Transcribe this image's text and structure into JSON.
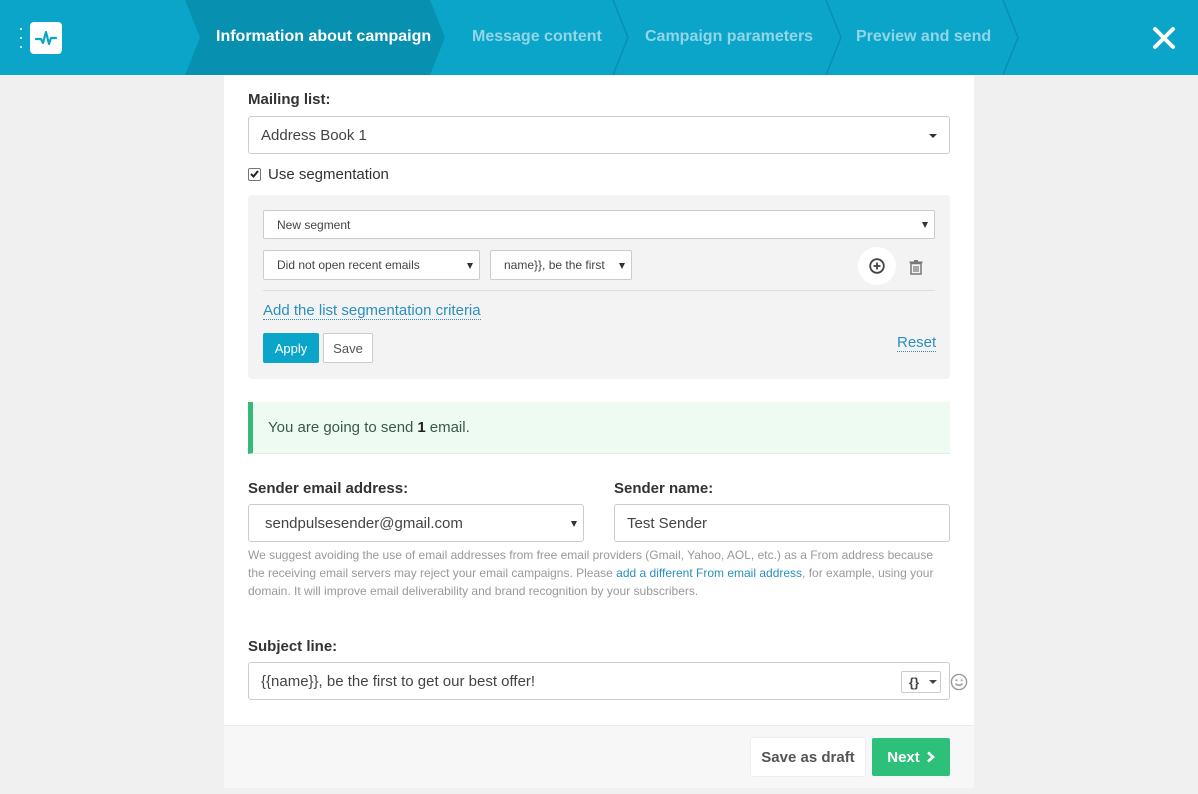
{
  "colors": {
    "topbar": "#0aa5c9",
    "active_step": "#0890b1",
    "apply": "#0aa5c9",
    "next": "#2dc07a",
    "link": "#2a8fbd",
    "alert_border": "#35b974"
  },
  "steps": [
    {
      "label": "Information about campaign",
      "active": true
    },
    {
      "label": "Message content",
      "active": false
    },
    {
      "label": "Campaign parameters",
      "active": false
    },
    {
      "label": "Preview and send",
      "active": false
    }
  ],
  "mailing_list": {
    "label": "Mailing list:",
    "value": "Address Book 1"
  },
  "segmentation": {
    "checkbox_label": "Use segmentation",
    "checked": true,
    "segment_select": "New segment",
    "criterion_select": "Did not open recent emails",
    "campaign_select": "name}}, be the first",
    "add_criteria_link": "Add the list segmentation criteria",
    "apply_label": "Apply",
    "save_label": "Save",
    "reset_label": "Reset"
  },
  "alert": {
    "prefix": "You are going to send",
    "count": "1",
    "suffix": "email."
  },
  "sender": {
    "email_label": "Sender email address:",
    "email_value": "sendpulsesender@gmail.com",
    "name_label": "Sender name:",
    "name_value": "Test Sender",
    "hint_before": "We suggest avoiding the use of email addresses from free email providers (Gmail, Yahoo, AOL, etc.) as a From address because the receiving email servers may reject your email campaigns. Please",
    "hint_link": "add a different From email address",
    "hint_after": ", for example, using your domain. It will improve email deliverability and brand recognition by your subscribers."
  },
  "subject": {
    "label": "Subject line:",
    "value": "{{name}}, be the first to get our best offer!",
    "var_button": "{}"
  },
  "footer": {
    "draft_label": "Save as draft",
    "next_label": "Next"
  }
}
